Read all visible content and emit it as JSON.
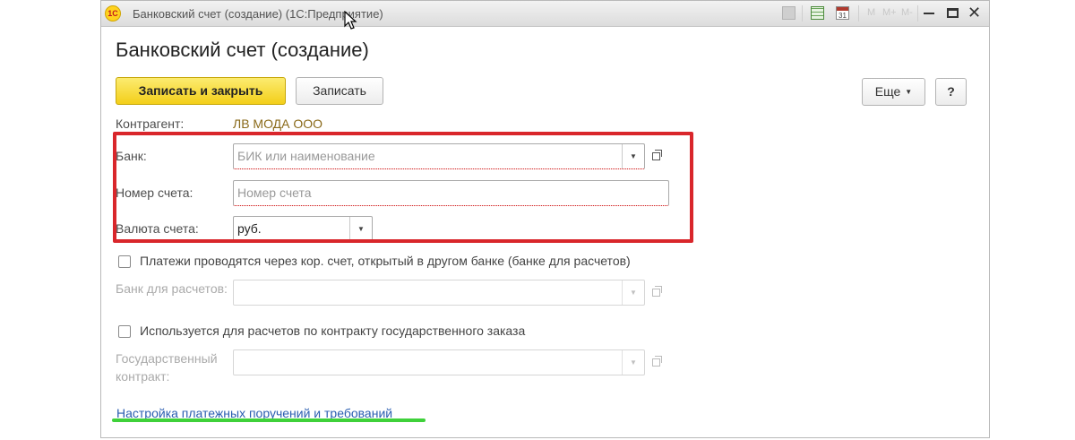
{
  "window": {
    "title": "Банковский счет (создание)  (1С:Предприятие)",
    "logo_text": "1С",
    "toolbar_icons": [
      "print-icon",
      "calculator-icon",
      "calendar-icon",
      "memory-m-icon",
      "memory-m-plus-icon",
      "memory-m-minus-icon",
      "minimize-icon",
      "maximize-icon",
      "close-icon"
    ],
    "calendar_day": "31",
    "m_labels": [
      "M",
      "M+",
      "M-"
    ],
    "close_glyph": "✕"
  },
  "form": {
    "heading": "Банковский счет (создание)",
    "buttons": {
      "save_close": "Записать и закрыть",
      "save": "Записать",
      "more": "Еще",
      "help": "?"
    },
    "contractor": {
      "label": "Контрагент:",
      "value": "ЛВ МОДА ООО"
    },
    "bank": {
      "label": "Банк:",
      "placeholder": "БИК или наименование"
    },
    "account_number": {
      "label": "Номер счета:",
      "placeholder": "Номер счета"
    },
    "currency": {
      "label": "Валюта счета:",
      "value": "руб."
    },
    "corr_account_checkbox": {
      "label": "Платежи проводятся через кор. счет, открытый в другом банке (банке для расчетов)",
      "checked": false
    },
    "settlement_bank": {
      "label": "Банк для расчетов:",
      "value": ""
    },
    "gov_contract_checkbox": {
      "label": "Используется для расчетов по контракту государственного заказа",
      "checked": false
    },
    "gov_contract": {
      "label": "Государственный контракт:",
      "value": ""
    },
    "settings_link": "Настройка платежных поручений и требований"
  },
  "colors": {
    "primary_button": "#f3cf19",
    "highlight_frame": "#d9262b",
    "underline_marker": "#3fd13a",
    "link": "#2a5db0",
    "contractor_value": "#8a6a1a"
  }
}
